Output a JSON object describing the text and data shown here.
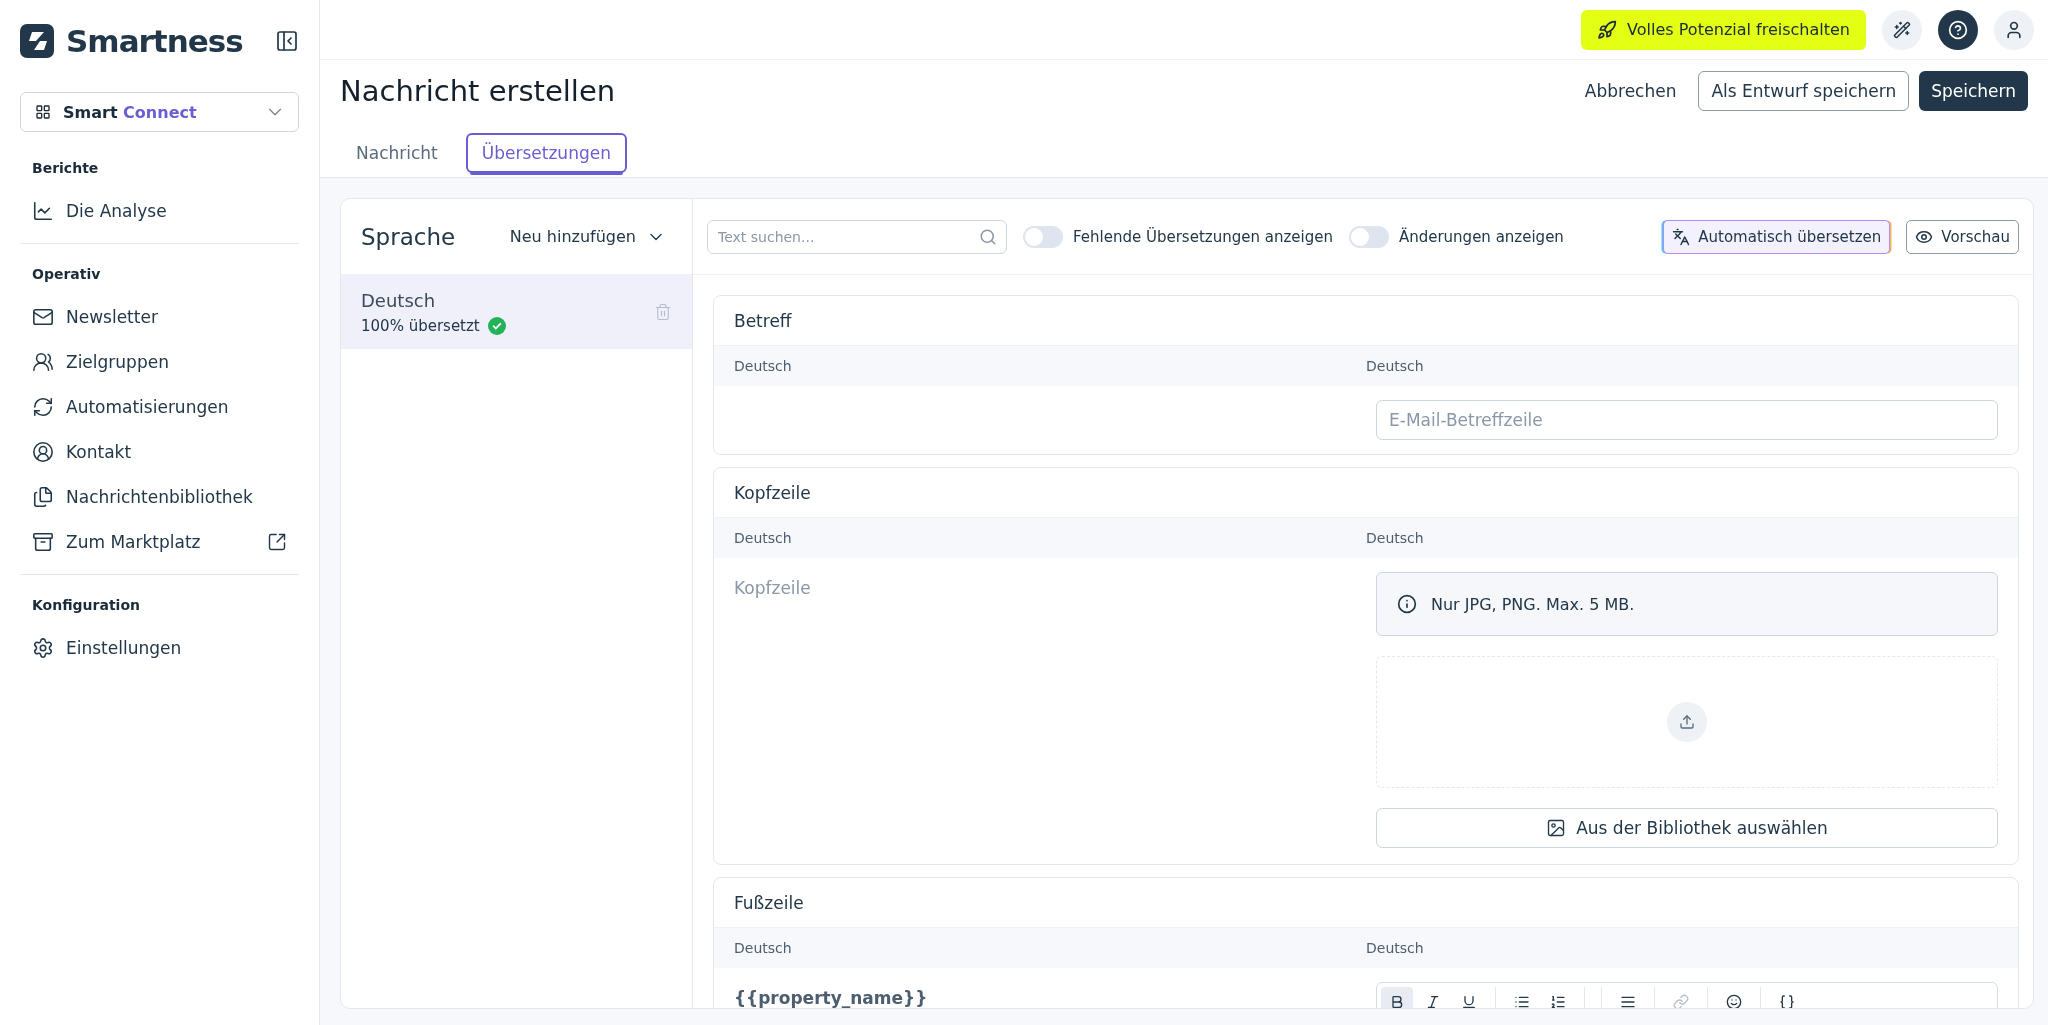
{
  "sidebar": {
    "logo": "Smartness",
    "product": {
      "prefix": "Smart",
      "name": "Connect"
    },
    "sections": [
      {
        "heading": "Berichte",
        "items": [
          {
            "label": "Die Analyse",
            "external": false
          }
        ]
      },
      {
        "heading": "Operativ",
        "items": [
          {
            "label": "Newsletter",
            "external": false
          },
          {
            "label": "Zielgruppen",
            "external": false
          },
          {
            "label": "Automatisierungen",
            "external": false
          },
          {
            "label": "Kontakt",
            "external": false
          },
          {
            "label": "Nachrichtenbibliothek",
            "external": false
          },
          {
            "label": "Zum Marktplatz",
            "external": true
          }
        ]
      },
      {
        "heading": "Konfiguration",
        "items": [
          {
            "label": "Einstellungen",
            "external": false
          }
        ]
      }
    ]
  },
  "topbar": {
    "upgrade_button": "Volles Potenzial freischalten"
  },
  "page": {
    "title": "Nachricht erstellen",
    "actions": [
      {
        "label": "Abbrechen",
        "kind": "link"
      },
      {
        "label": "Als Entwurf speichern",
        "kind": "outline"
      },
      {
        "label": "Speichern",
        "kind": "primary"
      }
    ]
  },
  "tabs": [
    {
      "label": "Nachricht",
      "selected": false
    },
    {
      "label": "Übersetzungen",
      "selected": true
    }
  ],
  "languages_panel": {
    "title": "Sprache",
    "add_button": "Neu hinzufügen",
    "languages": [
      {
        "name": "Deutsch",
        "status": "100% übersetzt",
        "complete": true,
        "selected": true
      }
    ]
  },
  "toolbar": {
    "search": {
      "placeholder": "Text suchen..."
    },
    "toggles": [
      {
        "label": "Fehlende Übersetzungen anzeigen",
        "on": false
      },
      {
        "label": "Änderungen anzeigen",
        "on": false
      }
    ],
    "auto_translate_button": "Automatisch übersetzen",
    "preview_button": "Vorschau"
  },
  "sections": [
    {
      "title": "Betreff",
      "kind": "text",
      "columns": [
        "Deutsch",
        "Deutsch"
      ],
      "placeholder": "E-Mail-Betreffzeile"
    },
    {
      "title": "Kopfzeile",
      "kind": "image",
      "columns": [
        "Deutsch",
        "Deutsch"
      ],
      "source": "Kopfzeile",
      "info": "Nur JPG, PNG. Max. 5 MB.",
      "library_button": "Aus der Bibliothek auswählen"
    },
    {
      "title": "Fußzeile",
      "kind": "rich",
      "columns": [
        "Deutsch",
        "Deutsch"
      ],
      "source": "{{property_name}}",
      "bold_active": true
    }
  ]
}
